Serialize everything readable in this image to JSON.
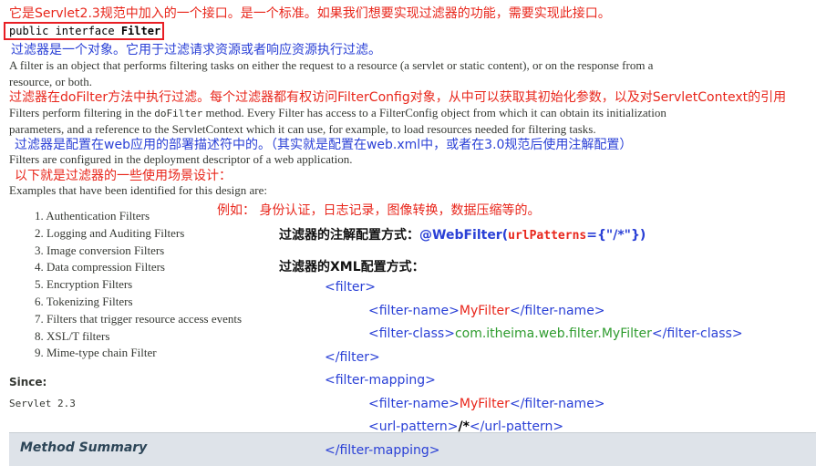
{
  "notes": {
    "intro": "它是Servlet2.3规范中加入的一个接口。是一个标准。如果我们想要实现过滤器的功能，需要实现此接口。",
    "is_object": "过滤器是一个对象。它用于过滤请求资源或者响应资源执行过滤。",
    "dofilter": "过滤器在doFilter方法中执行过滤。每个过滤器都有权访问FilterConfig对象，从中可以获取其初始化参数，以及对ServletContext的引用",
    "configured": "过滤器是配置在web应用的部署描述符中的。（其实就是配置在web.xml中，或者在3.0规范后使用注解配置）",
    "scenarios": "以下就是过滤器的一些使用场景设计：",
    "example": "例如：   身份认证，日志记录，图像转换，数据压缩等的。"
  },
  "signature": {
    "prefix": "public interface ",
    "name": "Filter"
  },
  "doc": {
    "para1_line1": "A filter is an object that performs filtering tasks on either the request to a resource (a servlet or static content), or on the response from a",
    "para1_line2": "resource, or both.",
    "para2_line1_a": "Filters perform filtering in the ",
    "para2_line1_code": "doFilter",
    "para2_line1_b": " method. Every Filter has access to a FilterConfig object from which it can obtain its initialization",
    "para2_line2": "parameters, and a reference to the ServletContext which it can use, for example, to load resources needed for filtering tasks.",
    "para3": "Filters are configured in the deployment descriptor of a web application.",
    "para4": "Examples that have been identified for this design are:"
  },
  "examples": [
    "1. Authentication Filters",
    "2. Logging and Auditing Filters",
    "3. Image conversion Filters",
    "4. Data compression Filters",
    "5. Encryption Filters",
    "6. Tokenizing Filters",
    "7. Filters that trigger resource access events",
    "8. XSL/T filters",
    "9. Mime-type chain Filter"
  ],
  "since": {
    "label": "Since:",
    "value": "Servlet 2.3"
  },
  "method_summary": "Method Summary",
  "annotation": {
    "label": "过滤器的注解配置方式：",
    "at": "@WebFilter(",
    "param": "urlPatterns",
    "rest": "={\"/*\"})"
  },
  "xml_config": {
    "label": "过滤器的XML配置方式：",
    "filter_open": "<filter>",
    "name_open": "<filter-name>",
    "name_value": "MyFilter",
    "name_close": "</filter-name>",
    "class_open": "<filter-class>",
    "class_value": "com.itheima.web.filter.MyFilter",
    "class_close": "</filter-class>",
    "filter_close": "</filter>",
    "mapping_open": "<filter-mapping>",
    "map_name_open": "<filter-name>",
    "map_name_value": "MyFilter",
    "map_name_close": "</filter-name>",
    "url_open": "<url-pattern>",
    "url_value": "/*",
    "url_close": "</url-pattern>",
    "mapping_close": "</filter-mapping>"
  },
  "colors": {
    "annotation_red": "#e8261b",
    "annotation_blue": "#2a40d6",
    "xml_tag_blue": "#2a40d6",
    "xml_class_green": "#2f9c2f",
    "highlight_box": "#e81e24",
    "method_bar_bg": "#dee3e9"
  }
}
